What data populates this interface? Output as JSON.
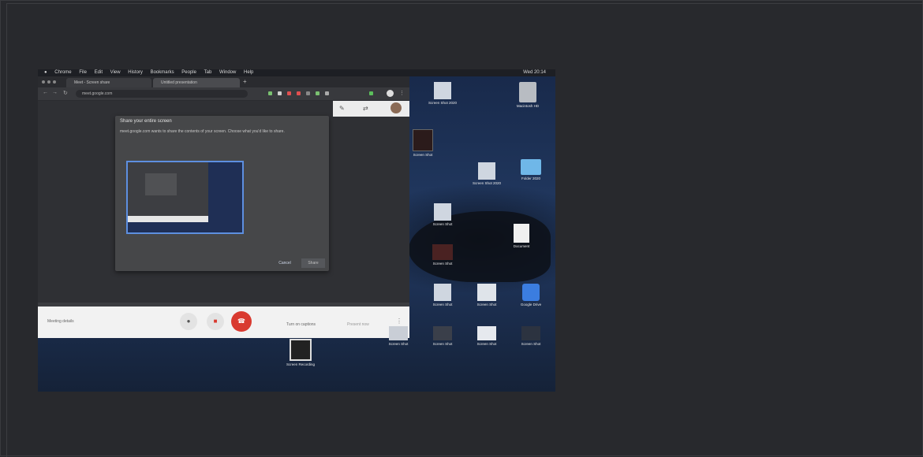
{
  "screenshot": {
    "menubar": {
      "items": [
        "Chrome",
        "File",
        "Edit",
        "View",
        "History",
        "Bookmarks",
        "People",
        "Tab",
        "Window",
        "Help"
      ],
      "clock": "Wed 20:14"
    },
    "browser": {
      "tabs": [
        "Meet - Screen share",
        "Untitled presentation"
      ],
      "url": "meet.google.com"
    },
    "dialog": {
      "title": "Share your entire screen",
      "description": "meet.google.com wants to share the contents of your screen. Choose what you'd like to share.",
      "cancel_label": "Cancel",
      "share_label": "Share"
    },
    "call_bar": {
      "meeting_details": "Meeting details",
      "turn_on_captions": "Turn on captions",
      "present_now": "Present now"
    },
    "desktop_icons": [
      "Screen Shot 2020",
      "Macintosh HD",
      "Screen Shot",
      "Screen Shot 2020",
      "Folder 2020",
      "Screen Shot",
      "Document",
      "Screen Shot",
      "Screen Shot",
      "Screen Shot",
      "Google Drive",
      "Screen Shot",
      "Screen Shot",
      "Screen Shot",
      "Screen Shot",
      "Screen Recording"
    ]
  }
}
